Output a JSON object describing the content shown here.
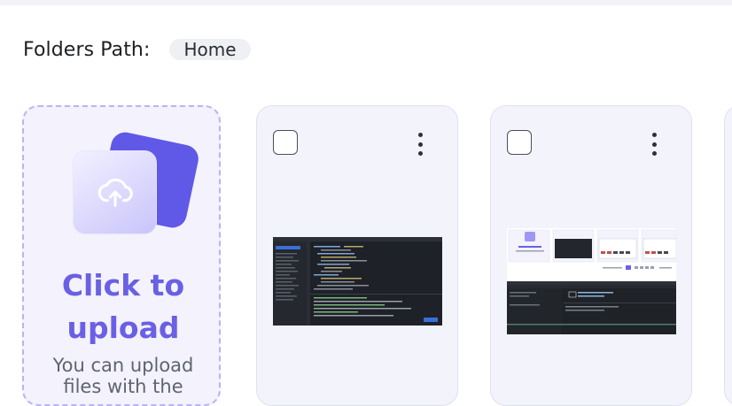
{
  "folders_path": {
    "label": "Folders Path:",
    "breadcrumb": [
      "Home"
    ]
  },
  "upload_card": {
    "title_line1": "Click to",
    "title_line2": "upload",
    "hint_line1": "You can upload",
    "hint_line2": "files with the"
  },
  "file_cards": [
    {
      "thumbnail": "code-editor-screenshot"
    },
    {
      "thumbnail": "upload-page-screenshot"
    }
  ],
  "colors": {
    "accent": "#6a60e4",
    "card_bg": "#f3f2fd",
    "dashed_border": "#b9b4f3"
  }
}
